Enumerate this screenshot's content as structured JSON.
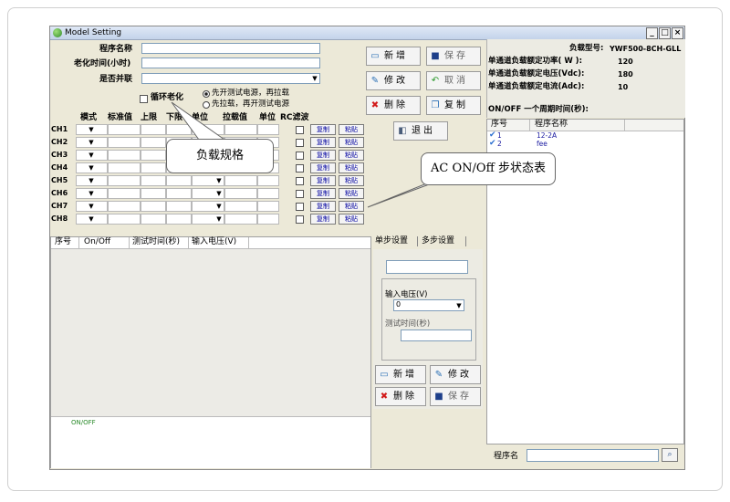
{
  "window": {
    "title": "Model Setting",
    "controls": [
      "_",
      "□",
      "×"
    ]
  },
  "form": {
    "program_name_label": "程序名称",
    "aging_time_label": "老化时间(小时)",
    "parallel_label": "是否并联",
    "cyclic_aging_label": "循环老化",
    "radio_power_first": "先开测试电源，再拉载",
    "radio_load_first": "先拉载，再开测试电源",
    "ch_headers": [
      "模式",
      "标准值",
      "上限",
      "下限",
      "单位",
      "拉载值",
      "单位",
      "RC滤波"
    ],
    "channels": [
      "CH1",
      "CH2",
      "CH3",
      "CH4",
      "CH5",
      "CH6",
      "CH7",
      "CH8"
    ],
    "copy_label": "复制",
    "paste_label": "粘贴"
  },
  "toolbar": {
    "new": "新增",
    "save": "保存",
    "edit": "修改",
    "cancel": "取消",
    "delete": "删除",
    "copy": "复制",
    "exit": "退出"
  },
  "info": {
    "model_label": "负载型号:",
    "model_value": "YWF500-8CH-GLL",
    "power_label": "单通道负载额定功率( W ):",
    "power_value": "120",
    "voltage_label": "单通道负载额定电压(Vdc):",
    "voltage_value": "180",
    "current_label": "单通道负载额定电流(Adc):",
    "current_value": "10",
    "cycle_label": "ON/OFF 一个周期时间(秒):"
  },
  "program_list": {
    "headers": [
      "序号",
      "程序名称"
    ],
    "rows": [
      {
        "no": "1",
        "name": "12-2A"
      },
      {
        "no": "2",
        "name": "fee"
      }
    ]
  },
  "step_table": {
    "headers": [
      "序号",
      "On/Off",
      "测试时间(秒)",
      "输入电压(V)"
    ],
    "footer_label": "ON/OFF"
  },
  "step_tabs": [
    "单步设置",
    "多步设置"
  ],
  "step_panel": {
    "input_voltage_label": "输入电压(V)",
    "input_voltage_value": "0",
    "test_time_label": "测试时间(秒)",
    "new": "新增",
    "edit": "修改",
    "delete": "删除",
    "save": "保存"
  },
  "search": {
    "label": "程序名",
    "button_icon": "binoculars-icon"
  },
  "callouts": {
    "load_spec": "负载规格",
    "acstate": "AC ON/Off 步状态表"
  },
  "colors": {
    "title_bar": "#c3d3ea",
    "panel": "#ece9d8",
    "callout_border": "#666666",
    "list_text": "#1a1aa0"
  }
}
